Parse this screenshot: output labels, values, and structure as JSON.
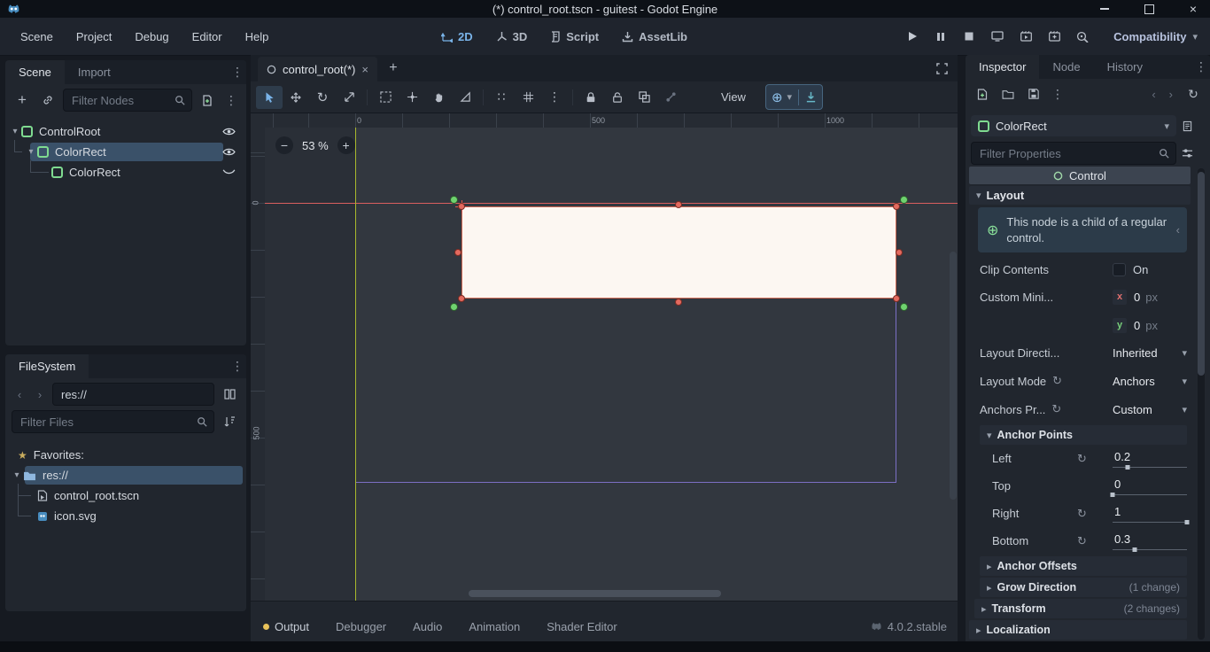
{
  "window": {
    "title": "(*) control_root.tscn - guitest - Godot Engine"
  },
  "menubar": {
    "items": [
      "Scene",
      "Project",
      "Debug",
      "Editor",
      "Help"
    ],
    "workspaces": [
      {
        "label": "2D"
      },
      {
        "label": "3D"
      },
      {
        "label": "Script"
      },
      {
        "label": "AssetLib"
      }
    ],
    "renderer": "Compatibility"
  },
  "scene_dock": {
    "tabs": [
      "Scene",
      "Import"
    ],
    "filter_placeholder": "Filter Nodes",
    "nodes": [
      {
        "name": "ControlRoot"
      },
      {
        "name": "ColorRect"
      },
      {
        "name": "ColorRect"
      }
    ]
  },
  "filesystem_dock": {
    "title": "FileSystem",
    "path": "res://",
    "filter_placeholder": "Filter Files",
    "favorites_label": "Favorites:",
    "root": "res://",
    "files": [
      "control_root.tscn",
      "icon.svg"
    ]
  },
  "viewport": {
    "scene_tab": "control_root(*)",
    "zoom": "53 %",
    "view_button": "View",
    "top_ruler": [
      "0",
      "500",
      "1000"
    ],
    "side_ruler": [
      "0",
      "500"
    ]
  },
  "bottom_panel": {
    "tabs": [
      "Output",
      "Debugger",
      "Audio",
      "Animation",
      "Shader Editor"
    ],
    "version": "4.0.2.stable"
  },
  "inspector": {
    "tabs": [
      "Inspector",
      "Node",
      "History"
    ],
    "object_name": "ColorRect",
    "filter_placeholder": "Filter Properties",
    "class_section": "Control",
    "category": "Layout",
    "notice": "This node is a child of a regular control.",
    "props": {
      "clip_contents": {
        "label": "Clip Contents",
        "value": "On"
      },
      "custom_min_size": {
        "label": "Custom Mini...",
        "x_label": "x",
        "x_value": "0",
        "x_unit": "px",
        "y_label": "y",
        "y_value": "0",
        "y_unit": "px"
      },
      "layout_direction": {
        "label": "Layout Directi...",
        "value": "Inherited",
        "revert": false
      },
      "layout_mode": {
        "label": "Layout Mode",
        "value": "Anchors",
        "revert": true
      },
      "anchors_preset": {
        "label": "Anchors Pr...",
        "value": "Custom",
        "revert": true
      }
    },
    "anchor_points": {
      "label": "Anchor Points",
      "rows": [
        {
          "label": "Left",
          "value": "0.2",
          "frac": 0.2,
          "revert": true
        },
        {
          "label": "Top",
          "value": "0",
          "frac": 0,
          "revert": false
        },
        {
          "label": "Right",
          "value": "1",
          "frac": 1,
          "revert": true
        },
        {
          "label": "Bottom",
          "value": "0.3",
          "frac": 0.3,
          "revert": true
        }
      ]
    },
    "groups": [
      {
        "label": "Anchor Offsets",
        "badge": ""
      },
      {
        "label": "Grow Direction",
        "badge": "(1 change)"
      },
      {
        "label": "Transform",
        "badge": "(2 changes)"
      },
      {
        "label": "Localization",
        "badge": ""
      }
    ]
  },
  "colors": {
    "accent": "#79b3e8",
    "node_green": "#7fdb90",
    "selection": "#3a5169",
    "output_dot": "#e8c25a",
    "guide_green": "#a9b92c",
    "guide_red": "#d95f5f",
    "bounds_purple": "#7b6fc4",
    "colorrect_fill": "#fcf7f2"
  }
}
